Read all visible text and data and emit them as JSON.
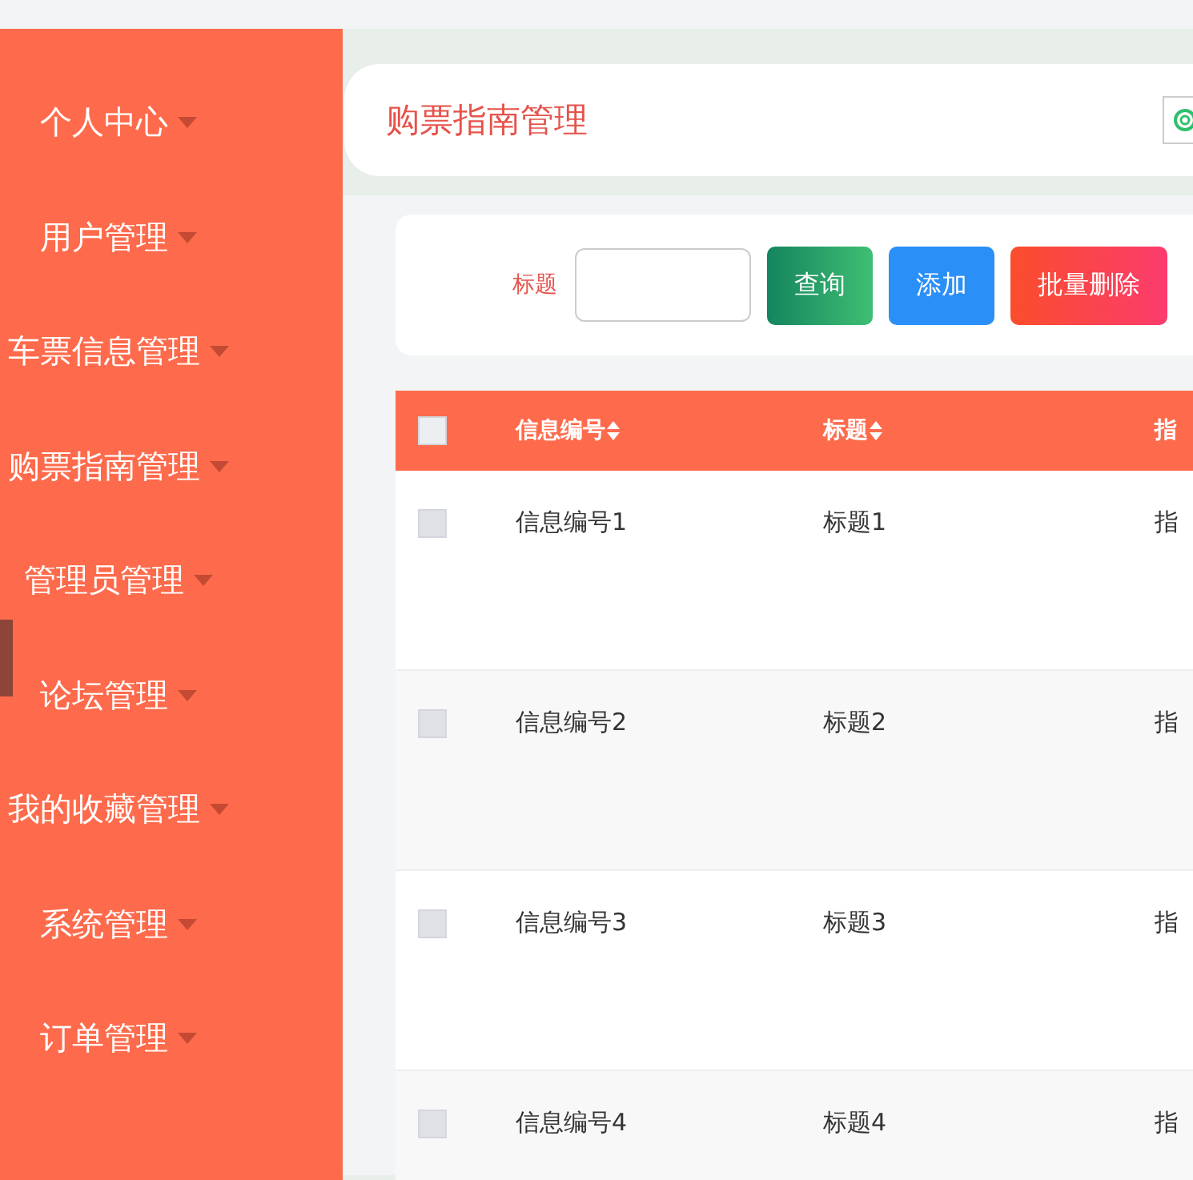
{
  "sidebar": {
    "items": [
      {
        "label": "个人中心"
      },
      {
        "label": "用户管理"
      },
      {
        "label": "车票信息管理"
      },
      {
        "label": "购票指南管理"
      },
      {
        "label": "管理员管理"
      },
      {
        "label": "论坛管理"
      },
      {
        "label": "我的收藏管理"
      },
      {
        "label": "系统管理"
      },
      {
        "label": "订单管理"
      }
    ]
  },
  "header": {
    "title": "购票指南管理"
  },
  "search": {
    "label": "标题",
    "buttons": [
      {
        "label": "查询",
        "kind": "search"
      },
      {
        "label": "添加",
        "kind": "add"
      },
      {
        "label": "批量删除",
        "kind": "delete"
      }
    ]
  },
  "table": {
    "select_all": {
      "checked": false
    },
    "columns": [
      {
        "label": "信息编号",
        "sortable": true
      },
      {
        "label": "标题",
        "sortable": true
      },
      {
        "label": "指",
        "sortable": false
      }
    ],
    "rows": [
      {
        "checked": false,
        "cells": [
          "信息编号1",
          "标题1",
          "指"
        ]
      },
      {
        "checked": false,
        "cells": [
          "信息编号2",
          "标题2",
          "指"
        ]
      },
      {
        "checked": false,
        "cells": [
          "信息编号3",
          "标题3",
          "指"
        ]
      },
      {
        "checked": false,
        "cells": [
          "信息编号4",
          "标题4",
          "指"
        ]
      }
    ]
  }
}
